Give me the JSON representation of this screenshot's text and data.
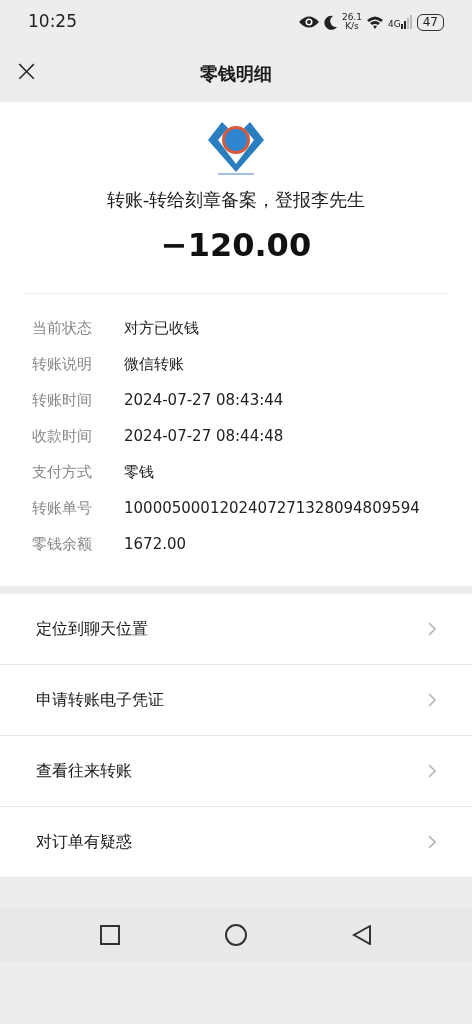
{
  "status_bar": {
    "time": "10:25",
    "speed": "26.1",
    "speed_unit": "K/s",
    "network": "4G",
    "battery": "47"
  },
  "header": {
    "close": "×",
    "title": "零钱明细"
  },
  "transfer": {
    "title": "转账-转给刻章备案，登报李先生",
    "amount": "−120.00"
  },
  "details": [
    {
      "label": "当前状态",
      "value": "对方已收钱"
    },
    {
      "label": "转账说明",
      "value": "微信转账"
    },
    {
      "label": "转账时间",
      "value": "2024-07-27 08:43:44"
    },
    {
      "label": "收款时间",
      "value": "2024-07-27 08:44:48"
    },
    {
      "label": "支付方式",
      "value": "零钱"
    },
    {
      "label": "转账单号",
      "value": "1000050001202407271328094809594"
    },
    {
      "label": "零钱余额",
      "value": "1672.00"
    }
  ],
  "actions": [
    {
      "label": "定位到聊天位置"
    },
    {
      "label": "申请转账电子凭证"
    },
    {
      "label": "查看往来转账"
    },
    {
      "label": "对订单有疑惑"
    }
  ]
}
